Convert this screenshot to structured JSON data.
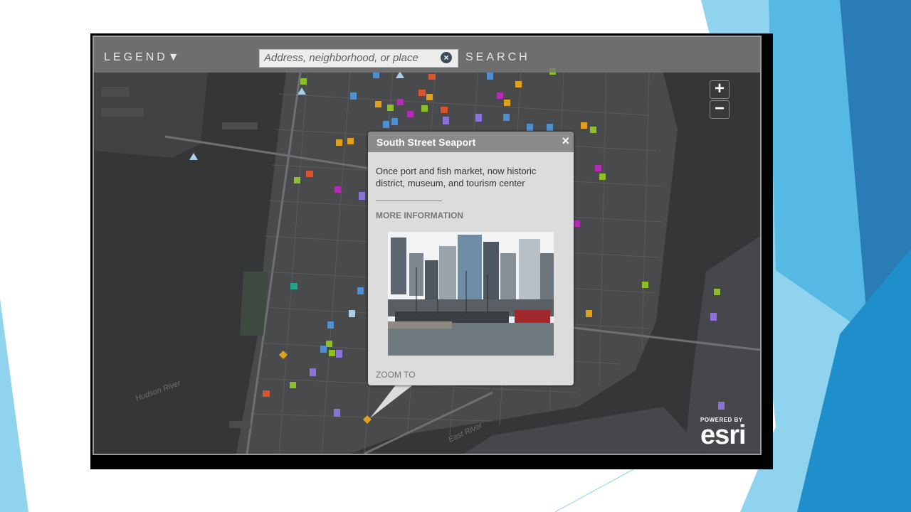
{
  "toolbar": {
    "legend_label": "LEGEND",
    "legend_icon": "triangle-down-icon",
    "search_placeholder": "Address, neighborhood, or place",
    "clear_icon": "clear-x-icon",
    "search_label": "SEARCH"
  },
  "zoom": {
    "in_label": "+",
    "out_label": "−"
  },
  "map_labels": {
    "hudson": "Hudson River",
    "east": "East River"
  },
  "popup": {
    "title": "South Street Seaport",
    "close_label": "×",
    "description": "Once port and fish market, now historic district, museum, and tourism center",
    "more_info": "MORE INFORMATION",
    "zoom_to": "ZOOM TO"
  },
  "attribution": {
    "powered_by": "POWERED BY",
    "brand": "esri"
  },
  "colors": {
    "map_bg": "#353638",
    "marker_blue": "#4f8fd0",
    "marker_magenta": "#b42bb4",
    "marker_green": "#8cbf2a",
    "marker_orange": "#e0a020",
    "marker_red": "#d8542c",
    "marker_purple": "#8a72d6",
    "marker_teal": "#1fa38a",
    "slide_blue": "#2a9fd6"
  }
}
